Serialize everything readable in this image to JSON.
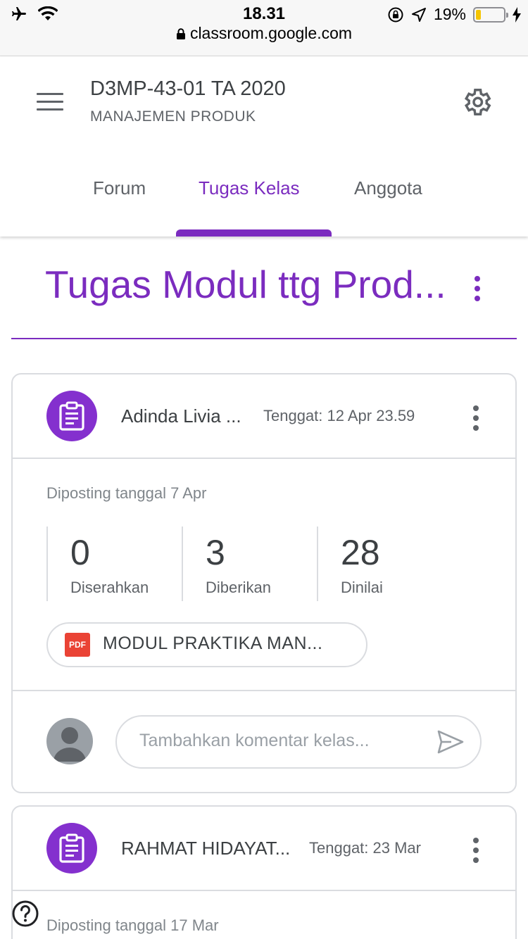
{
  "status_bar": {
    "time": "18.31",
    "url": "classroom.google.com",
    "battery": "19%",
    "battery_level": 0.19,
    "icons": [
      "airplane-icon",
      "wifi-icon",
      "rotation-lock-icon",
      "location-icon",
      "charging-icon"
    ]
  },
  "header": {
    "class_title": "D3MP-43-01 TA 2020",
    "class_subtitle": "MANAJEMEN PRODUK",
    "tabs": [
      {
        "label": "Forum",
        "active": false
      },
      {
        "label": "Tugas Kelas",
        "active": true
      },
      {
        "label": "Anggota",
        "active": false
      }
    ]
  },
  "topic": {
    "title": "Tugas Modul ttg Prod..."
  },
  "assignments": [
    {
      "student": "Adinda Livia ...",
      "due": "Tenggat: 12 Apr 23.59",
      "posted": "Diposting tanggal 7 Apr",
      "stats": [
        {
          "value": "0",
          "label": "Diserahkan"
        },
        {
          "value": "3",
          "label": "Diberikan"
        },
        {
          "value": "28",
          "label": "Dinilai"
        }
      ],
      "attachment": {
        "type": "PDF",
        "name": "MODUL PRAKTIKA MAN..."
      },
      "comment_placeholder": "Tambahkan komentar kelas..."
    },
    {
      "student": "RAHMAT HIDAYAT...",
      "due": "Tenggat: 23 Mar",
      "posted": "Diposting tanggal 17 Mar"
    }
  ],
  "colors": {
    "accent": "#7b2cbf",
    "icon_circle": "#8430ce",
    "pdf": "#ea4335",
    "border": "#dadce0"
  }
}
